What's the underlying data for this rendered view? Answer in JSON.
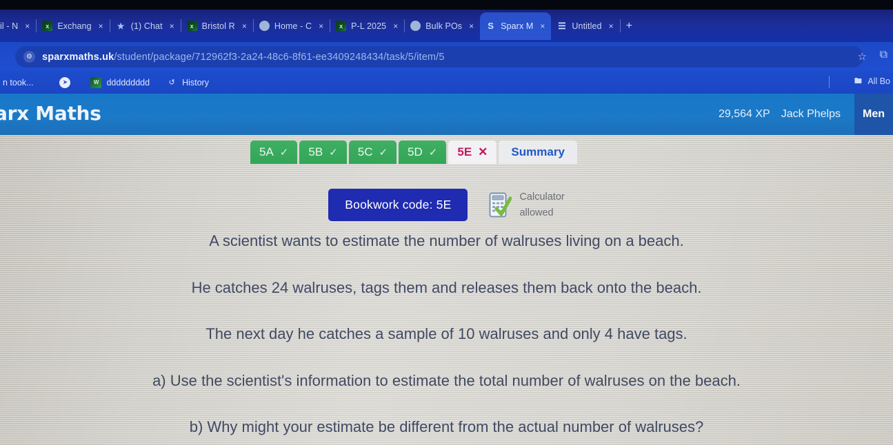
{
  "browser": {
    "tabs": [
      {
        "title": "il - N",
        "favicon": "mail-icon",
        "active": false
      },
      {
        "title": "Exchang",
        "favicon": "excel-icon",
        "active": false
      },
      {
        "title": "(1) Chat",
        "favicon": "teams-icon",
        "active": false
      },
      {
        "title": "Bristol R",
        "favicon": "excel-icon",
        "active": false
      },
      {
        "title": "Home - C",
        "favicon": "generic-icon",
        "active": false
      },
      {
        "title": "P-L 2025",
        "favicon": "excel-icon",
        "active": false
      },
      {
        "title": "Bulk POs",
        "favicon": "generic-icon",
        "active": false
      },
      {
        "title": "Sparx M",
        "favicon": "sparx-icon",
        "active": true
      },
      {
        "title": "Untitled",
        "favicon": "doc-icon",
        "active": false
      }
    ],
    "close_label": "×",
    "new_tab_label": "+",
    "url": {
      "domain": "sparxmaths.uk",
      "path": "/student/package/712962f3-2a24-48c6-8f61-ee3409248434/task/5/item/5",
      "site_icon": "tune-icon",
      "star_icon": "☆",
      "extensions_icon": "⧉"
    },
    "bookmarks": [
      {
        "label": "n took...",
        "icon": "none"
      },
      {
        "label": "",
        "icon": "share-circle-icon"
      },
      {
        "label": "ddddddddd",
        "icon": "green-square-icon"
      },
      {
        "label": "History",
        "icon": "history-icon"
      }
    ],
    "all_bookmarks_label": "All Bo",
    "all_bookmarks_icon": "folder-icon"
  },
  "app_header": {
    "brand": "arx Maths",
    "xp": "29,564 XP",
    "user": "Jack Phelps",
    "menu_label": "Men"
  },
  "part_tabs": [
    {
      "label": "5A",
      "state": "done",
      "mark": "✓"
    },
    {
      "label": "5B",
      "state": "done",
      "mark": "✓"
    },
    {
      "label": "5C",
      "state": "done",
      "mark": "✓"
    },
    {
      "label": "5D",
      "state": "done",
      "mark": "✓"
    },
    {
      "label": "5E",
      "state": "wrong",
      "mark": "✕"
    },
    {
      "label": "Summary",
      "state": "summary",
      "mark": ""
    }
  ],
  "question": {
    "bookwork_code": "Bookwork code: 5E",
    "calculator_line1": "Calculator",
    "calculator_line2": "allowed",
    "calculator_icon": "calculator-check-icon",
    "lines": [
      "A scientist wants to estimate the number of walruses living on a beach.",
      "He catches 24 walruses, tags them and releases them back onto the beach.",
      "The next day he catches a sample of 10 walruses and only 4 have tags.",
      "a) Use the scientist's information to estimate the total number of walruses on the beach.",
      "b) Why might your estimate be different from the actual number of walruses?"
    ]
  },
  "colors": {
    "tab_blue": "#1c2d99",
    "url_blue": "#1f4fd1",
    "sparx_header": "#1878c8",
    "part_done_green": "#3faf62",
    "part_wrong_red": "#c2185b",
    "summary_blue": "#2257c7",
    "bookwork_navy": "#1f2bb0",
    "question_text": "#3f4a63"
  }
}
